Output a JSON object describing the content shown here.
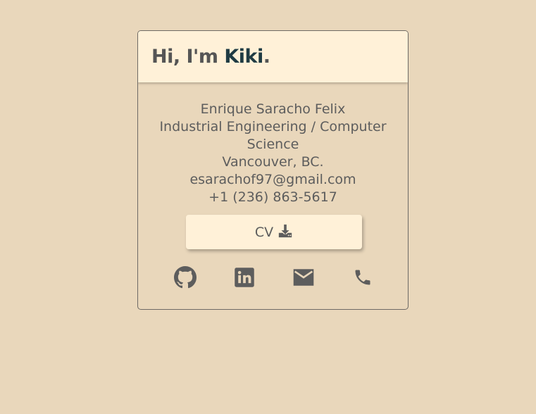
{
  "header": {
    "greeting_prefix": "Hi, I'm ",
    "name": "Kiki",
    "greeting_suffix": "."
  },
  "info": {
    "full_name": "Enrique Saracho Felix",
    "field_line1": "Industrial Engineering / Computer",
    "field_line2": "Science",
    "location": "Vancouver, BC.",
    "email": "esarachof97@gmail.com",
    "phone": "+1 (236) 863-5617"
  },
  "cv_button": {
    "label": "CV",
    "icon": "download-icon"
  },
  "socials": [
    {
      "icon": "github-icon"
    },
    {
      "icon": "linkedin-icon"
    },
    {
      "icon": "mail-icon"
    },
    {
      "icon": "phone-icon"
    }
  ],
  "colors": {
    "background": "#e9d7bb",
    "card_header": "#fff1d8",
    "name_accent": "#1f3b43",
    "text": "#5d5d5d"
  }
}
